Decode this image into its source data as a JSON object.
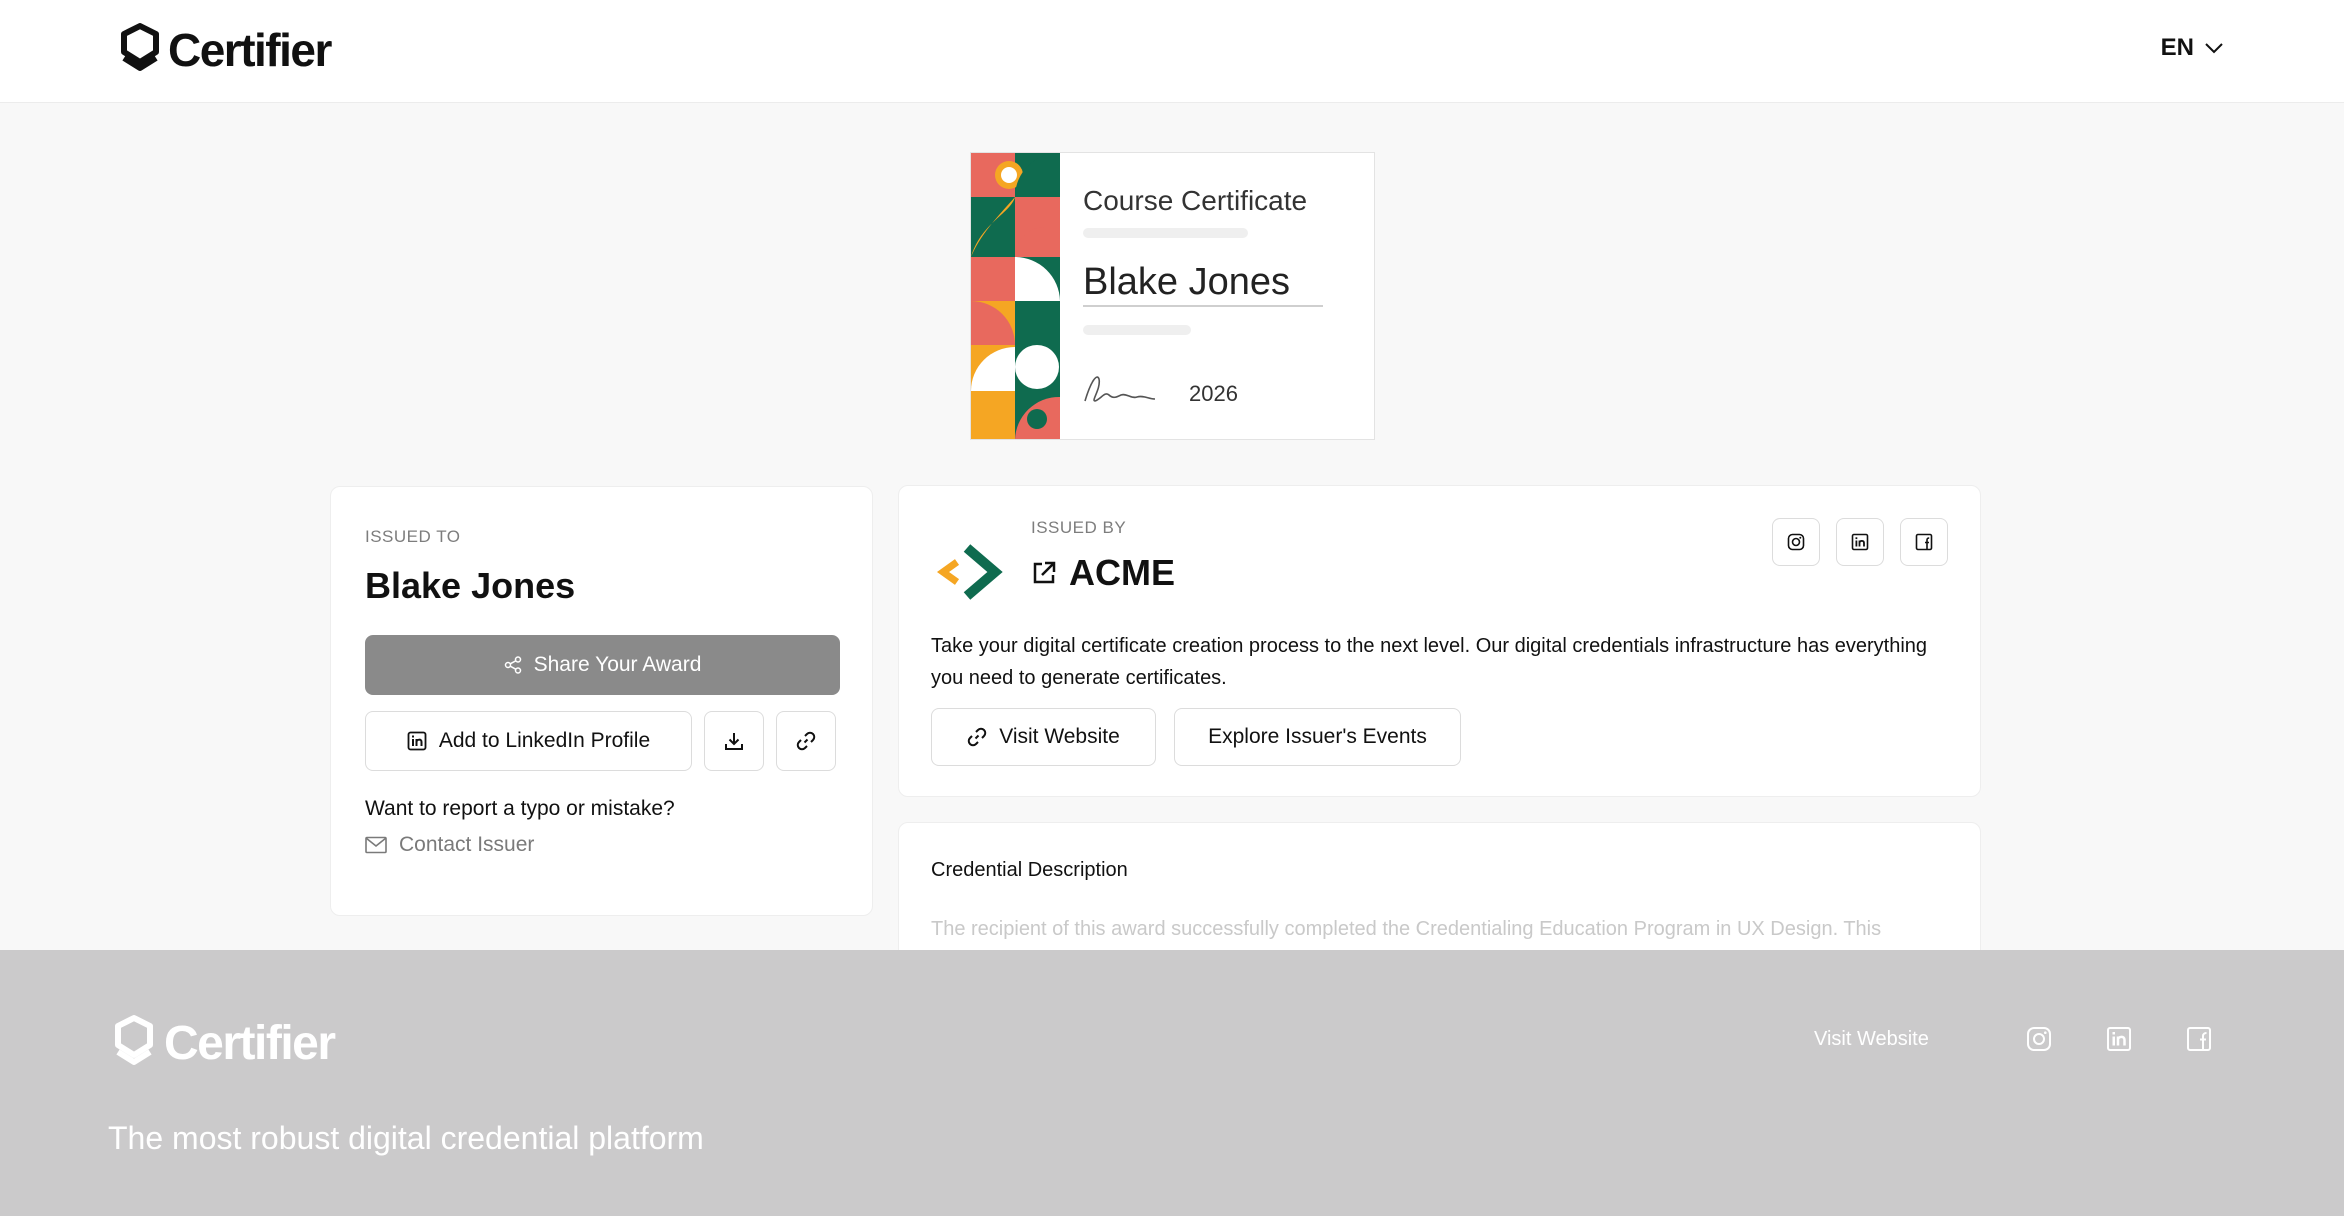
{
  "header": {
    "brand": "Certifier",
    "language": "EN"
  },
  "certificate": {
    "title": "Course Certificate",
    "recipient": "Blake Jones",
    "year": "2026"
  },
  "issued_to": {
    "label": "ISSUED TO",
    "name": "Blake Jones",
    "share_label": "Share Your Award",
    "linkedin_label": "Add to LinkedIn Profile",
    "report_text": "Want to report a typo or mistake?",
    "contact_label": "Contact Issuer"
  },
  "issued_by": {
    "label": "ISSUED BY",
    "name": "ACME",
    "description": "Take your digital certificate creation process to the next level. Our digital credentials infrastructure has everything you need to generate certificates.",
    "visit_label": "Visit Website",
    "events_label": "Explore Issuer's Events",
    "socials": [
      "instagram-icon",
      "linkedin-icon",
      "facebook-icon"
    ]
  },
  "credential": {
    "title": "Credential Description",
    "text": "The recipient of this award successfully completed the Credentialing Education Program in UX Design. This"
  },
  "footer": {
    "brand": "Certifier",
    "tagline": "The most robust digital credential platform",
    "visit_label": "Visit Website"
  },
  "colors": {
    "accent_green": "#0f6b4f",
    "accent_orange": "#f5a623",
    "accent_coral": "#e8695e",
    "share_button": "#8a8a8a",
    "footer_bg": "#cbcacb"
  }
}
